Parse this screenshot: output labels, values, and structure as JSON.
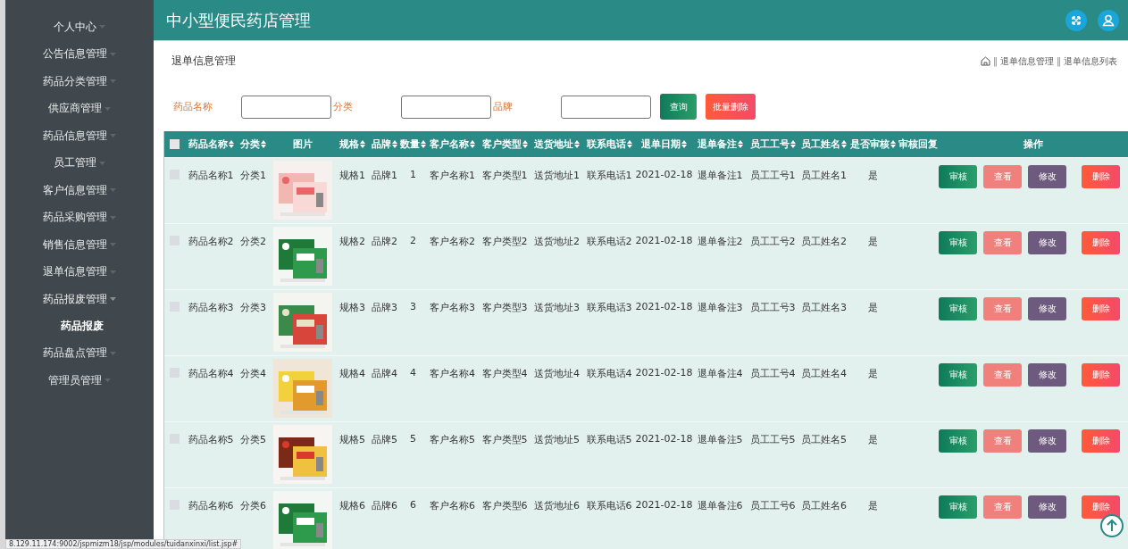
{
  "sidebar": {
    "items": [
      {
        "label": "个人中心",
        "expanded": false
      },
      {
        "label": "公告信息管理",
        "expanded": false
      },
      {
        "label": "药品分类管理",
        "expanded": false
      },
      {
        "label": "供应商管理",
        "expanded": false
      },
      {
        "label": "药品信息管理",
        "expanded": false
      },
      {
        "label": "员工管理",
        "expanded": false
      },
      {
        "label": "客户信息管理",
        "expanded": false
      },
      {
        "label": "药品采购管理",
        "expanded": false
      },
      {
        "label": "销售信息管理",
        "expanded": false
      },
      {
        "label": "退单信息管理",
        "expanded": false
      },
      {
        "label": "药品报废管理",
        "expanded": true,
        "children": [
          {
            "label": "药品报废"
          }
        ]
      },
      {
        "label": "药品盘点管理",
        "expanded": false
      },
      {
        "label": "管理员管理",
        "expanded": false
      }
    ]
  },
  "header": {
    "title": "中小型便民药店管理"
  },
  "page": {
    "title": "退单信息管理",
    "breadcrumb": [
      {
        "separator": "‖",
        "label": "退单信息管理"
      },
      {
        "separator": "‖",
        "label": "退单信息列表"
      }
    ]
  },
  "search": {
    "fields": [
      {
        "label": "药品名称"
      },
      {
        "label": "分类"
      },
      {
        "label": "品牌"
      }
    ],
    "buttons": [
      {
        "label": "查询",
        "kind": "query"
      },
      {
        "label": "批量删除",
        "kind": "delete"
      }
    ]
  },
  "table": {
    "select_all_checked": false,
    "columns": [
      {
        "label": "药品名称",
        "sortable": true
      },
      {
        "label": "分类",
        "sortable": true
      },
      {
        "label": "图片",
        "sortable": false
      },
      {
        "label": "规格",
        "sortable": true
      },
      {
        "label": "品牌",
        "sortable": true
      },
      {
        "label": "数量",
        "sortable": true
      },
      {
        "label": "客户名称",
        "sortable": true
      },
      {
        "label": "客户类型",
        "sortable": true
      },
      {
        "label": "送货地址",
        "sortable": true
      },
      {
        "label": "联系电话",
        "sortable": true
      },
      {
        "label": "退单日期",
        "sortable": true
      },
      {
        "label": "退单备注",
        "sortable": true
      },
      {
        "label": "员工工号",
        "sortable": true
      },
      {
        "label": "员工姓名",
        "sortable": true
      },
      {
        "label": "是否审核",
        "sortable": true
      },
      {
        "label": "审核回复",
        "sortable": false
      },
      {
        "label": "操作",
        "sortable": false
      }
    ],
    "rows": [
      {
        "checked": false,
        "cells": [
          "药品名称1",
          "分类1",
          {
            "kind": "picture"
          },
          "规格1",
          "品牌1",
          "1",
          "客户名称1",
          "客户类型1",
          "送货地址1",
          "联系电话1",
          "2021-02-18",
          "退单备注1",
          "员工工号1",
          "员工姓名1",
          "是"
        ],
        "actions": [
          {
            "label": "审核",
            "kind": "review"
          },
          {
            "label": "查看",
            "kind": "view"
          },
          {
            "label": "修改",
            "kind": "edit"
          },
          {
            "label": "删除",
            "kind": "delete"
          }
        ]
      },
      {
        "checked": false,
        "cells": [
          "药品名称2",
          "分类2",
          {
            "kind": "picture"
          },
          "规格2",
          "品牌2",
          "2",
          "客户名称2",
          "客户类型2",
          "送货地址2",
          "联系电话2",
          "2021-02-18",
          "退单备注2",
          "员工工号2",
          "员工姓名2",
          "是"
        ],
        "actions": [
          {
            "label": "审核",
            "kind": "review"
          },
          {
            "label": "查看",
            "kind": "view"
          },
          {
            "label": "修改",
            "kind": "edit"
          },
          {
            "label": "删除",
            "kind": "delete"
          }
        ]
      },
      {
        "checked": false,
        "cells": [
          "药品名称3",
          "分类3",
          {
            "kind": "picture"
          },
          "规格3",
          "品牌3",
          "3",
          "客户名称3",
          "客户类型3",
          "送货地址3",
          "联系电话3",
          "2021-02-18",
          "退单备注3",
          "员工工号3",
          "员工姓名3",
          "是"
        ],
        "actions": [
          {
            "label": "审核",
            "kind": "review"
          },
          {
            "label": "查看",
            "kind": "view"
          },
          {
            "label": "修改",
            "kind": "edit"
          },
          {
            "label": "删除",
            "kind": "delete"
          }
        ]
      },
      {
        "checked": false,
        "cells": [
          "药品名称4",
          "分类4",
          {
            "kind": "picture"
          },
          "规格4",
          "品牌4",
          "4",
          "客户名称4",
          "客户类型4",
          "送货地址4",
          "联系电话4",
          "2021-02-18",
          "退单备注4",
          "员工工号4",
          "员工姓名4",
          "是"
        ],
        "actions": [
          {
            "label": "审核",
            "kind": "review"
          },
          {
            "label": "查看",
            "kind": "view"
          },
          {
            "label": "修改",
            "kind": "edit"
          },
          {
            "label": "删除",
            "kind": "delete"
          }
        ]
      },
      {
        "checked": false,
        "cells": [
          "药品名称5",
          "分类5",
          {
            "kind": "picture"
          },
          "规格5",
          "品牌5",
          "5",
          "客户名称5",
          "客户类型5",
          "送货地址5",
          "联系电话5",
          "2021-02-18",
          "退单备注5",
          "员工工号5",
          "员工姓名5",
          "是"
        ],
        "actions": [
          {
            "label": "审核",
            "kind": "review"
          },
          {
            "label": "查看",
            "kind": "view"
          },
          {
            "label": "修改",
            "kind": "edit"
          },
          {
            "label": "删除",
            "kind": "delete"
          }
        ]
      },
      {
        "checked": false,
        "cells": [
          "药品名称6",
          "分类6",
          {
            "kind": "picture"
          },
          "规格6",
          "品牌6",
          "6",
          "客户名称6",
          "客户类型6",
          "送货地址6",
          "联系电话6",
          "2021-02-18",
          "退单备注6",
          "员工工号6",
          "员工姓名6",
          "是"
        ],
        "actions": [
          {
            "label": "审核",
            "kind": "review"
          },
          {
            "label": "查看",
            "kind": "view"
          },
          {
            "label": "修改",
            "kind": "edit"
          },
          {
            "label": "删除",
            "kind": "delete"
          }
        ]
      }
    ]
  },
  "status_bar": {
    "url": "8.129.11.174:9002/jspmizm18/jsp/modules/tuidanxinxi/list.jsp#"
  }
}
